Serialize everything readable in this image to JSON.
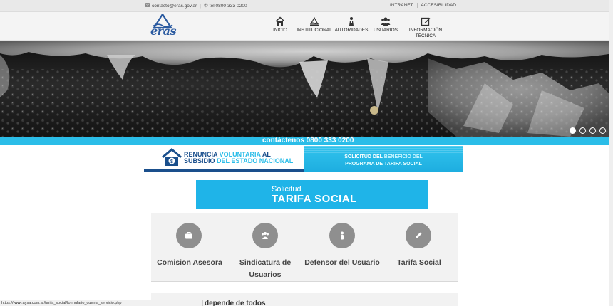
{
  "topbar": {
    "email": "contacto@eras.gov.ar",
    "phone": "tel 0800-333-0200",
    "links": [
      "INTRANET",
      "ACCESIBILIDAD"
    ]
  },
  "header": {
    "logo_text": "eras",
    "nav": [
      {
        "label": "INICIO",
        "icon": "home-icon"
      },
      {
        "label": "INSTITUCIONAL",
        "icon": "institution-icon"
      },
      {
        "label": "AUTORIDADES",
        "icon": "authority-icon"
      },
      {
        "label": "USUARIOS",
        "icon": "users-icon"
      },
      {
        "label": "INFORMACIÓN TÉCNICA",
        "icon": "edit-icon"
      }
    ]
  },
  "hero": {
    "slides": 4,
    "active_slide": 1
  },
  "strip": {
    "text": "contáctenos 0800 333 0200"
  },
  "banners": {
    "left_line1a": "RENUNCIA ",
    "left_line1b": "VOLUNTARIA",
    "left_line1c": " AL",
    "left_line2a": "SUBSIDIO ",
    "left_line2b": "DEL ESTADO NACIONAL",
    "right_line1a": "SOLICITUD DEL ",
    "right_line1b": "BENEFICIO DEL",
    "right_line2": "PROGRAMA DE TARIFA SOCIAL"
  },
  "tarifa": {
    "small": "Solicitud",
    "big": "TARIFA SOCIAL"
  },
  "services": [
    {
      "label": "Comision Asesora",
      "icon": "briefcase-icon"
    },
    {
      "label": "Sindicatura de Usuarios",
      "icon": "group-icon"
    },
    {
      "label": "Defensor del Usuario",
      "icon": "person-icon"
    },
    {
      "label": "Tarifa Social",
      "icon": "pencil-icon"
    }
  ],
  "partial_heading": "depende de todos",
  "status_url": "https://www.aysa.com.ar/tarifa_social/formulario_cuenta_servicio.php",
  "colors": {
    "accent": "#2bbde8",
    "navy": "#1a4f8c",
    "tarifa": "#1fb4e8"
  }
}
